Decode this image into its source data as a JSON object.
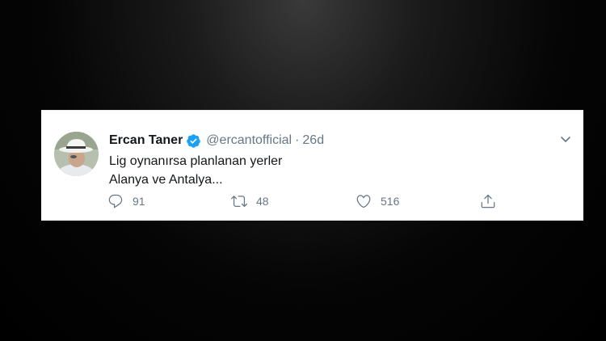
{
  "tweet": {
    "author_name": "Ercan Taner",
    "handle": "@ercantofficial",
    "separator": "·",
    "time": "26d",
    "text_lines": [
      "Lig oynanırsa planlanan yerler",
      "Alanya ve Antalya..."
    ],
    "verified": true,
    "actions": {
      "reply_count": "91",
      "retweet_count": "48",
      "like_count": "516"
    }
  },
  "icons": {
    "verified": "verified-badge-icon",
    "more": "chevron-down-icon",
    "reply": "reply-icon",
    "retweet": "retweet-icon",
    "like": "heart-icon",
    "share": "share-icon"
  },
  "colors": {
    "verified_blue": "#1da1f2",
    "secondary_text": "#657786",
    "primary_text": "#14171a",
    "page_background": "#000000",
    "card_background": "#ffffff"
  }
}
